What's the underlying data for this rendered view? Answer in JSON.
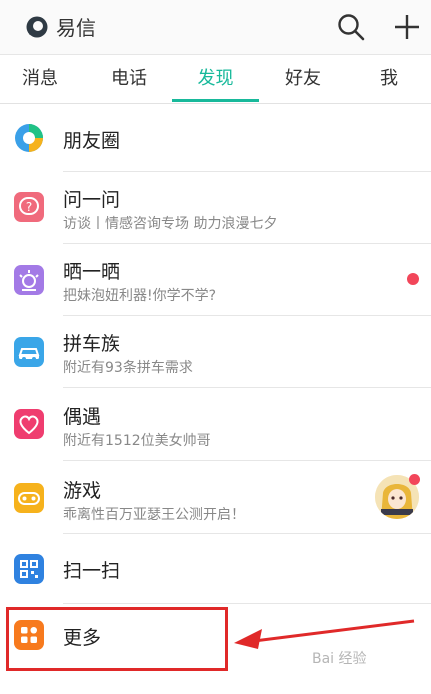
{
  "header": {
    "app_title": "易信",
    "icons": [
      "yixin-logo-icon",
      "search-icon",
      "plus-icon"
    ]
  },
  "tabs": [
    {
      "label": "消息",
      "active": false
    },
    {
      "label": "电话",
      "active": false
    },
    {
      "label": "发现",
      "active": true
    },
    {
      "label": "好友",
      "active": false
    },
    {
      "label": "我",
      "active": false
    }
  ],
  "list": [
    {
      "title": "朋友圈",
      "subtitle": "",
      "icon": "friends-circle-icon"
    },
    {
      "title": "问一问",
      "subtitle": "访谈丨情感咨询专场 助力浪漫七夕",
      "icon": "question-icon"
    },
    {
      "title": "晒一晒",
      "subtitle": "把妹泡妞利器!你学不学?",
      "icon": "sun-icon",
      "badge": "red-dot"
    },
    {
      "title": "拼车族",
      "subtitle": "附近有93条拼车需求",
      "icon": "car-icon"
    },
    {
      "title": "偶遇",
      "subtitle": "附近有1512位美女帅哥",
      "icon": "heart-icon"
    },
    {
      "title": "游戏",
      "subtitle": "乖离性百万亚瑟王公测开启！",
      "icon": "game-icon",
      "badge": "red-dot",
      "avatar": "game-avatar"
    },
    {
      "title": "扫一扫",
      "subtitle": "",
      "icon": "qr-scan-icon"
    },
    {
      "title": "更多",
      "subtitle": "",
      "icon": "more-grid-icon"
    }
  ],
  "colors": {
    "accent": "#18b99b",
    "badge": "#f2465a",
    "annotation": "#e02929"
  },
  "watermark": "Bai 经验"
}
